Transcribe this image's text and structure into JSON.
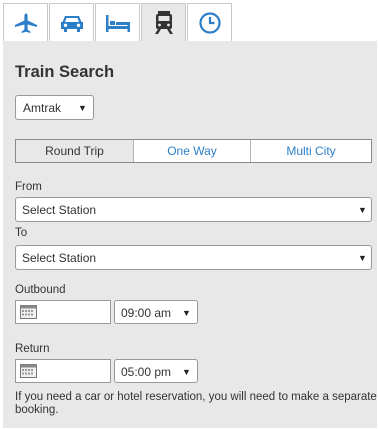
{
  "tabs": [
    {
      "icon": "airplane-icon",
      "active": false
    },
    {
      "icon": "car-icon",
      "active": false
    },
    {
      "icon": "hotel-bed-icon",
      "active": false
    },
    {
      "icon": "train-icon",
      "active": true
    },
    {
      "icon": "clock-icon",
      "active": false
    }
  ],
  "colors": {
    "accent": "#2c7ec8",
    "panel": "#e8e8e8",
    "text": "#333333"
  },
  "form": {
    "title": "Train Search",
    "carrier": {
      "value": "Amtrak"
    },
    "trip_types": [
      "Round Trip",
      "One Way",
      "Multi City"
    ],
    "trip_selected": "Round Trip",
    "from": {
      "label": "From",
      "value": "Select Station"
    },
    "to": {
      "label": "To",
      "value": "Select Station"
    },
    "outbound": {
      "label": "Outbound",
      "date": "",
      "time": "09:00 am"
    },
    "return": {
      "label": "Return",
      "date": "",
      "time": "05:00 pm"
    },
    "note": "If you need a car or hotel reservation, you will need to make a separate booking."
  }
}
